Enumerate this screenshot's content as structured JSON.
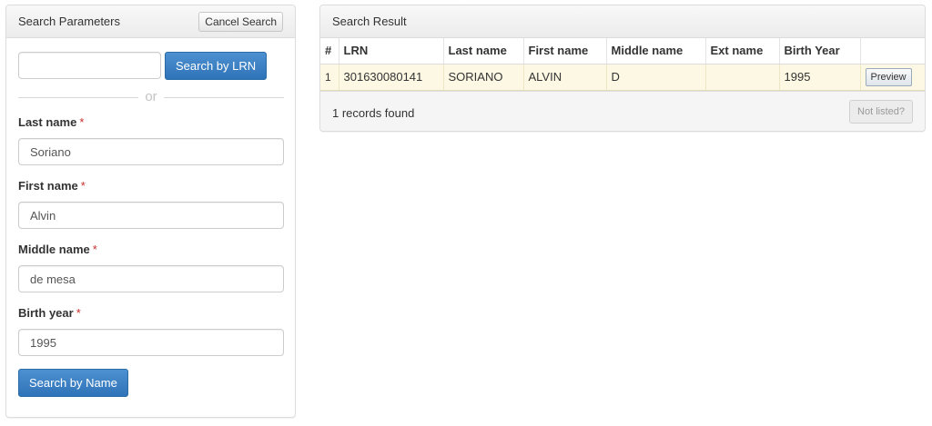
{
  "search_params": {
    "title": "Search Parameters",
    "cancel_label": "Cancel Search",
    "lrn_input": {
      "value": "",
      "placeholder": ""
    },
    "search_lrn_label": "Search by LRN",
    "or_text": "or",
    "required_mark": "*",
    "fields": {
      "last_name": {
        "label": "Last name",
        "value": "Soriano"
      },
      "first_name": {
        "label": "First name",
        "value": "Alvin"
      },
      "middle_name": {
        "label": "Middle name",
        "value": "de mesa"
      },
      "birth_year": {
        "label": "Birth year",
        "value": "1995"
      }
    },
    "search_name_label": "Search by Name"
  },
  "search_result": {
    "title": "Search Result",
    "columns": [
      "#",
      "LRN",
      "Last name",
      "First name",
      "Middle name",
      "Ext name",
      "Birth Year"
    ],
    "rows": [
      {
        "num": "1",
        "lrn": "301630080141",
        "last_name": "SORIANO",
        "first_name": "ALVIN",
        "middle_name": "D",
        "ext_name": "",
        "birth_year": "1995",
        "action": "Preview"
      }
    ],
    "records_found": "1 records found",
    "not_listed_label": "Not listed?"
  },
  "colors": {
    "primary": "#337ab7",
    "highlight_row": "#fcf8e3",
    "required": "#c9302c"
  }
}
